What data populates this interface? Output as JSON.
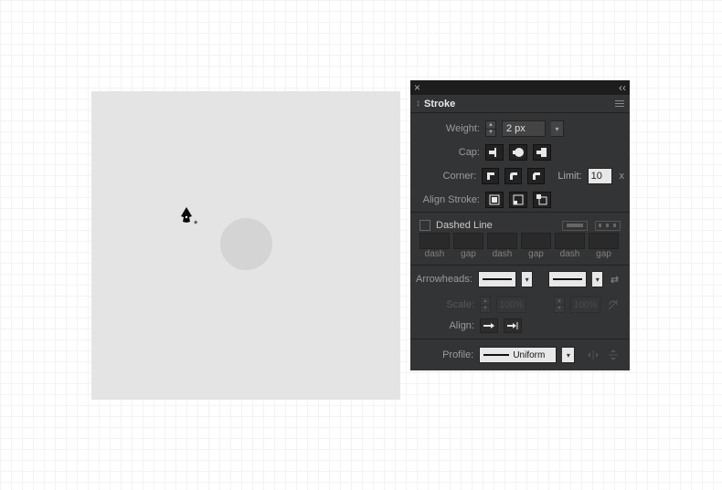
{
  "panel": {
    "title": "Stroke",
    "weight_label": "Weight:",
    "weight_value": "2 px",
    "cap_label": "Cap:",
    "corner_label": "Corner:",
    "limit_label": "Limit:",
    "limit_value": "10",
    "limit_suffix": "x",
    "align_stroke_label": "Align Stroke:",
    "dashed_label": "Dashed Line",
    "dash_labels": [
      "dash",
      "gap",
      "dash",
      "gap",
      "dash",
      "gap"
    ],
    "arrowheads_label": "Arrowheads:",
    "scale_label": "Scale:",
    "scale_value": "100%",
    "align_label": "Align:",
    "profile_label": "Profile:",
    "profile_value": "Uniform"
  }
}
